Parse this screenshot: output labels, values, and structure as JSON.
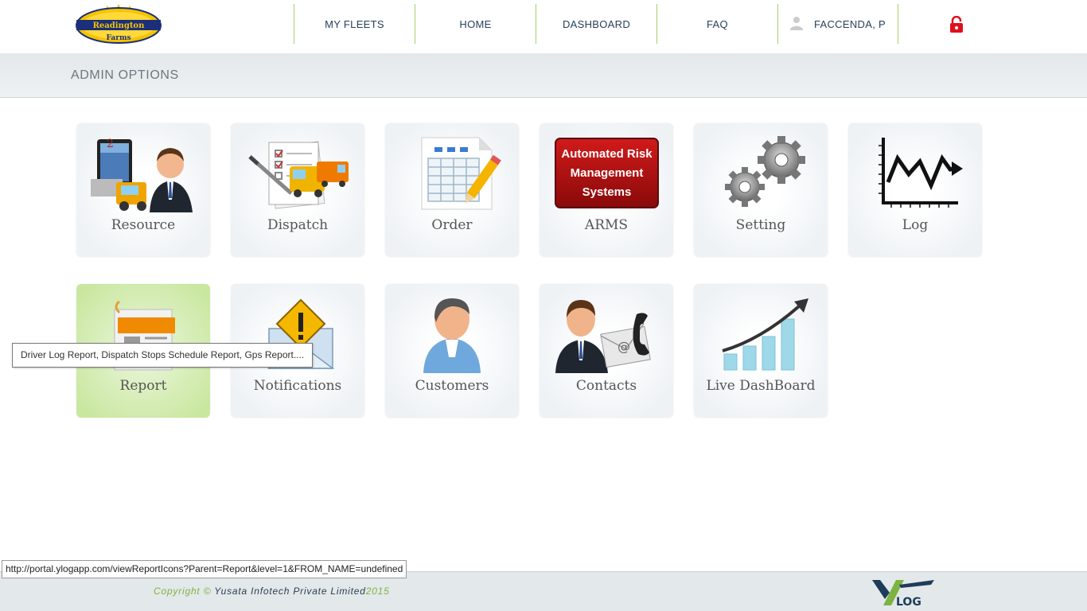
{
  "header": {
    "logo_text_top": "Readington",
    "logo_text_bottom": "Farms",
    "nav": [
      {
        "label": "MY FLEETS"
      },
      {
        "label": "HOME"
      },
      {
        "label": "DASHBOARD"
      },
      {
        "label": "FAQ"
      },
      {
        "label": "FACCENDA, P"
      }
    ]
  },
  "admin": {
    "title": "ADMIN OPTIONS"
  },
  "tiles": {
    "resource": {
      "label": "Resource",
      "badge": "2"
    },
    "dispatch": {
      "label": "Dispatch"
    },
    "order": {
      "label": "Order"
    },
    "arms": {
      "label": "ARMS",
      "box_lines": [
        "Automated Risk",
        "Management",
        "Systems"
      ]
    },
    "setting": {
      "label": "Setting"
    },
    "log": {
      "label": "Log"
    },
    "report": {
      "label": "Report"
    },
    "notifications": {
      "label": "Notifications"
    },
    "customers": {
      "label": "Customers"
    },
    "contacts": {
      "label": "Contacts"
    },
    "live_dashboard": {
      "label": "Live DashBoard"
    }
  },
  "tooltip": {
    "text": "Driver Log Report, Dispatch Stops Schedule Report, Gps Report...."
  },
  "status_url": "http://portal.ylogapp.com/viewReportIcons?Parent=Report&level=1&FROM_NAME=undefined",
  "footer": {
    "copyright_prefix": "Copyright ©",
    "company": " Yusata Infotech Private Limited",
    "year": "2015",
    "logo_text": "LOG"
  },
  "colors": {
    "nav_divider": "#a9cf6a",
    "nav_text": "#26415a",
    "active_tile": "#c9e79f",
    "accent_green": "#7cb342",
    "lock_red": "#e0101a"
  }
}
